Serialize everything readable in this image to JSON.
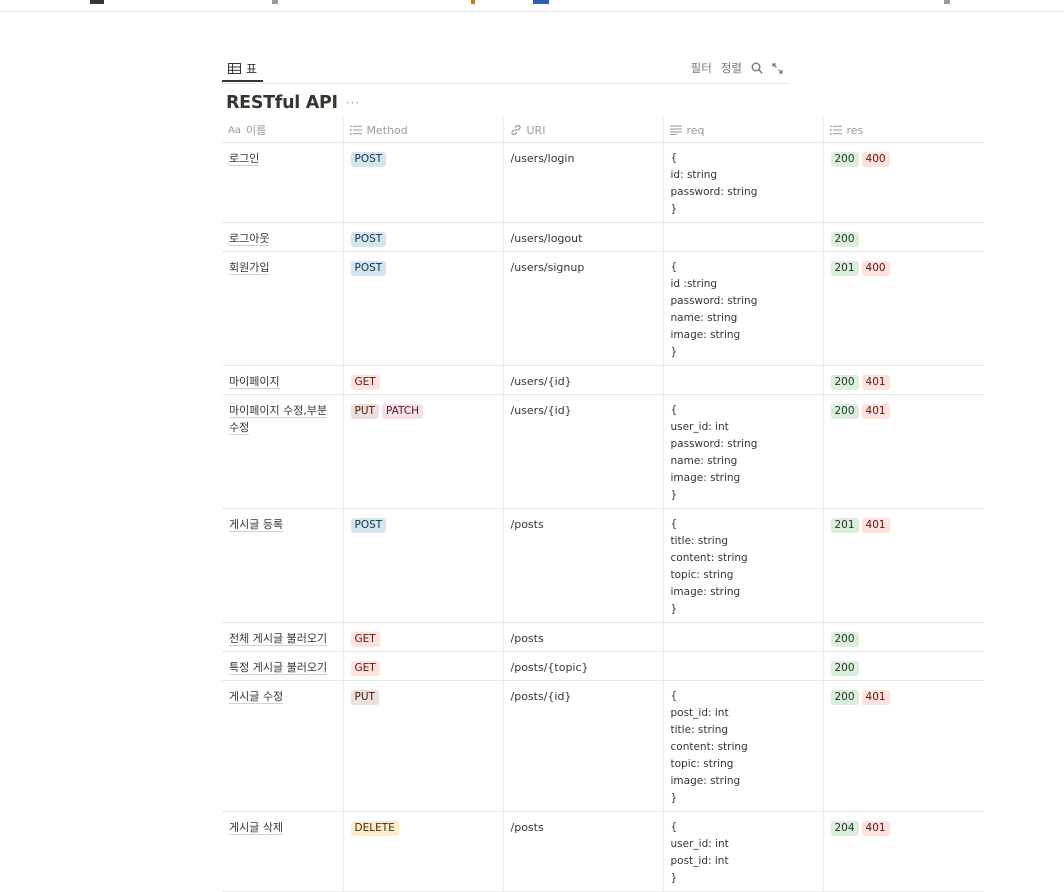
{
  "view": {
    "tab_label": "표",
    "actions": {
      "filter": "필터",
      "sort": "정렬"
    },
    "icons": {
      "table": "table-icon",
      "search": "search-icon",
      "expand": "expand-icon"
    }
  },
  "database": {
    "title": "RESTful API",
    "more": "···",
    "columns": [
      {
        "label": "이름",
        "icon": "Aa"
      },
      {
        "label": "Method",
        "icon": "list-icon"
      },
      {
        "label": "URI",
        "icon": "link-icon"
      },
      {
        "label": "req",
        "icon": "text-icon"
      },
      {
        "label": "res",
        "icon": "list-icon"
      }
    ],
    "rows": [
      {
        "name": "로그인",
        "methods": [
          "POST"
        ],
        "uri": "/users/login",
        "req": "{\nid: string\npassword: string\n}",
        "res": [
          "200",
          "400"
        ]
      },
      {
        "name": "로그아웃",
        "methods": [
          "POST"
        ],
        "uri": "/users/logout",
        "req": "",
        "res": [
          "200"
        ]
      },
      {
        "name": "회원가입",
        "methods": [
          "POST"
        ],
        "uri": "/users/signup",
        "req": "{\nid :string\npassword: string\nname: string\nimage: string\n}",
        "res": [
          "201",
          "400"
        ]
      },
      {
        "name": "마이페이지",
        "methods": [
          "GET"
        ],
        "uri": "/users/{id}",
        "req": "",
        "res": [
          "200",
          "401"
        ]
      },
      {
        "name": "마이페이지 수정,부분 수정",
        "methods": [
          "PUT",
          "PATCH"
        ],
        "uri": "/users/{id}",
        "req": "{\nuser_id: int\npassword: string\nname: string\nimage: string\n}",
        "res": [
          "200",
          "401"
        ]
      },
      {
        "name": "게시글 등록",
        "methods": [
          "POST"
        ],
        "uri": "/posts",
        "req": "{\ntitle: string\ncontent: string\ntopic: string\nimage: string\n}",
        "res": [
          "201",
          "401"
        ]
      },
      {
        "name": "전체 게시글 불러오기",
        "methods": [
          "GET"
        ],
        "uri": "/posts",
        "req": "",
        "res": [
          "200"
        ]
      },
      {
        "name": "특정 게시글 불러오기",
        "methods": [
          "GET"
        ],
        "uri": "/posts/{topic}",
        "req": "",
        "res": [
          "200"
        ]
      },
      {
        "name": "게시글 수정",
        "methods": [
          "PUT"
        ],
        "uri": "/posts/{id}",
        "req": "{\npost_id: int\ntitle: string\ncontent: string\ntopic: string\nimage: string\n}",
        "res": [
          "200",
          "401"
        ]
      },
      {
        "name": "게시글 삭제",
        "methods": [
          "DELETE"
        ],
        "uri": "/posts",
        "req": "{\nuser_id: int\npost_id: int\n}",
        "res": [
          "204",
          "401"
        ]
      }
    ]
  },
  "tag_colors": {
    "POST": {
      "bg": "#d3e5ef",
      "fg": "#183347"
    },
    "GET": {
      "bg": "#ffe2dd",
      "fg": "#5d1715"
    },
    "PUT": {
      "bg": "#eedfdb",
      "fg": "#441d12"
    },
    "PATCH": {
      "bg": "#f5e0e9",
      "fg": "#4c2337"
    },
    "DELETE": {
      "bg": "#fdecc8",
      "fg": "#402c1b"
    },
    "200": {
      "bg": "#dbeddb",
      "fg": "#1c3829"
    },
    "201": {
      "bg": "#dbeddb",
      "fg": "#1c3829"
    },
    "204": {
      "bg": "#dbeddb",
      "fg": "#1c3829"
    },
    "400": {
      "bg": "#ffe2dd",
      "fg": "#5d1715"
    },
    "401": {
      "bg": "#ffe2dd",
      "fg": "#5d1715"
    }
  }
}
